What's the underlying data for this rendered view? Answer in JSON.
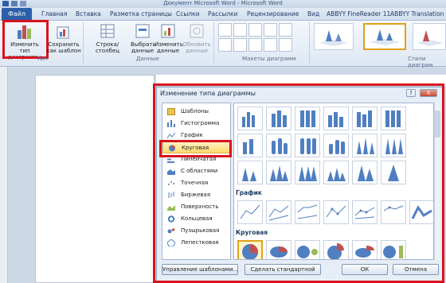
{
  "window": {
    "title": "Документ Microsoft Word - Microsoft Word"
  },
  "menu_tabs": [
    "Файл",
    "Главная",
    "Вставка",
    "Разметка страницы",
    "Ссылки",
    "Рассылки",
    "Рецензирование",
    "Вид",
    "ABBYY FineReader 11",
    "ABBYY Translation"
  ],
  "ribbon": {
    "change_type_line1": "Изменить тип",
    "change_type_line2": "диаграммы",
    "save_template_line1": "Сохранить",
    "save_template_line2": "как шаблон",
    "group_type": "Тип",
    "row_col": "Строка/столбец",
    "select_data_line1": "Выбрать",
    "select_data_line2": "данные",
    "edit_data_line1": "Изменить",
    "edit_data_line2": "данные",
    "refresh_data_line1": "Обновить",
    "refresh_data_line2": "данные",
    "group_data": "Данные",
    "group_layouts": "Макеты диаграмм",
    "group_styles": "Стили диаграм"
  },
  "dialog": {
    "title": "Изменение типа диаграммы",
    "help": "?",
    "close": "X",
    "categories": [
      "Шаблоны",
      "Гистограмма",
      "График",
      "Круговая",
      "Линейчатая",
      "С областями",
      "Точечная",
      "Биржевая",
      "Поверхность",
      "Кольцевая",
      "Пузырьковая",
      "Лепестковая"
    ],
    "selected_category": "Круговая",
    "section_line": "График",
    "section_pie": "Круговая",
    "btn_manage": "Управление шаблонами...",
    "btn_default": "Сделать стандартной",
    "btn_ok": "ОК",
    "btn_cancel": "Отмена"
  },
  "colors": {
    "accent": "#2b5fa9",
    "highlight": "#d9131e",
    "selection": "#ffd96b"
  }
}
